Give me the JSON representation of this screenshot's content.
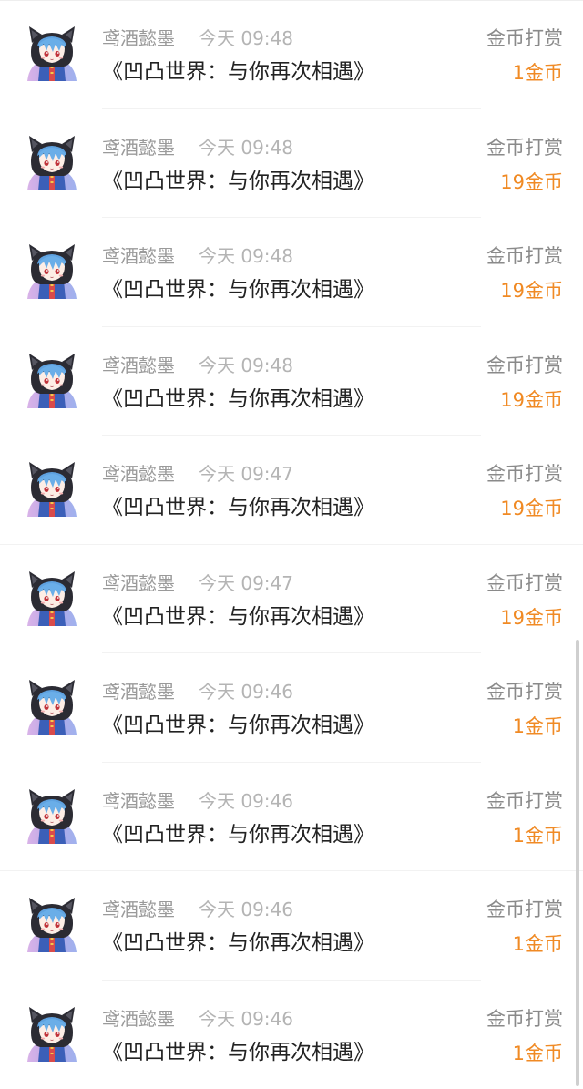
{
  "records": [
    {
      "name": "鸢酒懿墨",
      "time": "今天 09:48",
      "book": "《凹凸世界：与你再次相遇》",
      "label": "金币打赏",
      "amount": "1金币"
    },
    {
      "name": "鸢酒懿墨",
      "time": "今天 09:48",
      "book": "《凹凸世界：与你再次相遇》",
      "label": "金币打赏",
      "amount": "19金币"
    },
    {
      "name": "鸢酒懿墨",
      "time": "今天 09:48",
      "book": "《凹凸世界：与你再次相遇》",
      "label": "金币打赏",
      "amount": "19金币"
    },
    {
      "name": "鸢酒懿墨",
      "time": "今天 09:48",
      "book": "《凹凸世界：与你再次相遇》",
      "label": "金币打赏",
      "amount": "19金币"
    },
    {
      "name": "鸢酒懿墨",
      "time": "今天 09:47",
      "book": "《凹凸世界：与你再次相遇》",
      "label": "金币打赏",
      "amount": "19金币"
    },
    {
      "name": "鸢酒懿墨",
      "time": "今天 09:47",
      "book": "《凹凸世界：与你再次相遇》",
      "label": "金币打赏",
      "amount": "19金币"
    },
    {
      "name": "鸢酒懿墨",
      "time": "今天 09:46",
      "book": "《凹凸世界：与你再次相遇》",
      "label": "金币打赏",
      "amount": "1金币"
    },
    {
      "name": "鸢酒懿墨",
      "time": "今天 09:46",
      "book": "《凹凸世界：与你再次相遇》",
      "label": "金币打赏",
      "amount": "1金币"
    },
    {
      "name": "鸢酒懿墨",
      "time": "今天 09:46",
      "book": "《凹凸世界：与你再次相遇》",
      "label": "金币打赏",
      "amount": "1金币"
    },
    {
      "name": "鸢酒懿墨",
      "time": "今天 09:46",
      "book": "《凹凸世界：与你再次相遇》",
      "label": "金币打赏",
      "amount": "1金币"
    }
  ],
  "colors": {
    "amount": "#f08a24",
    "name": "#9a9a9a",
    "time": "#b4b4b4",
    "book": "#222222",
    "label": "#8a8a8a"
  },
  "icons": {
    "avatar": "avatar-icon"
  }
}
